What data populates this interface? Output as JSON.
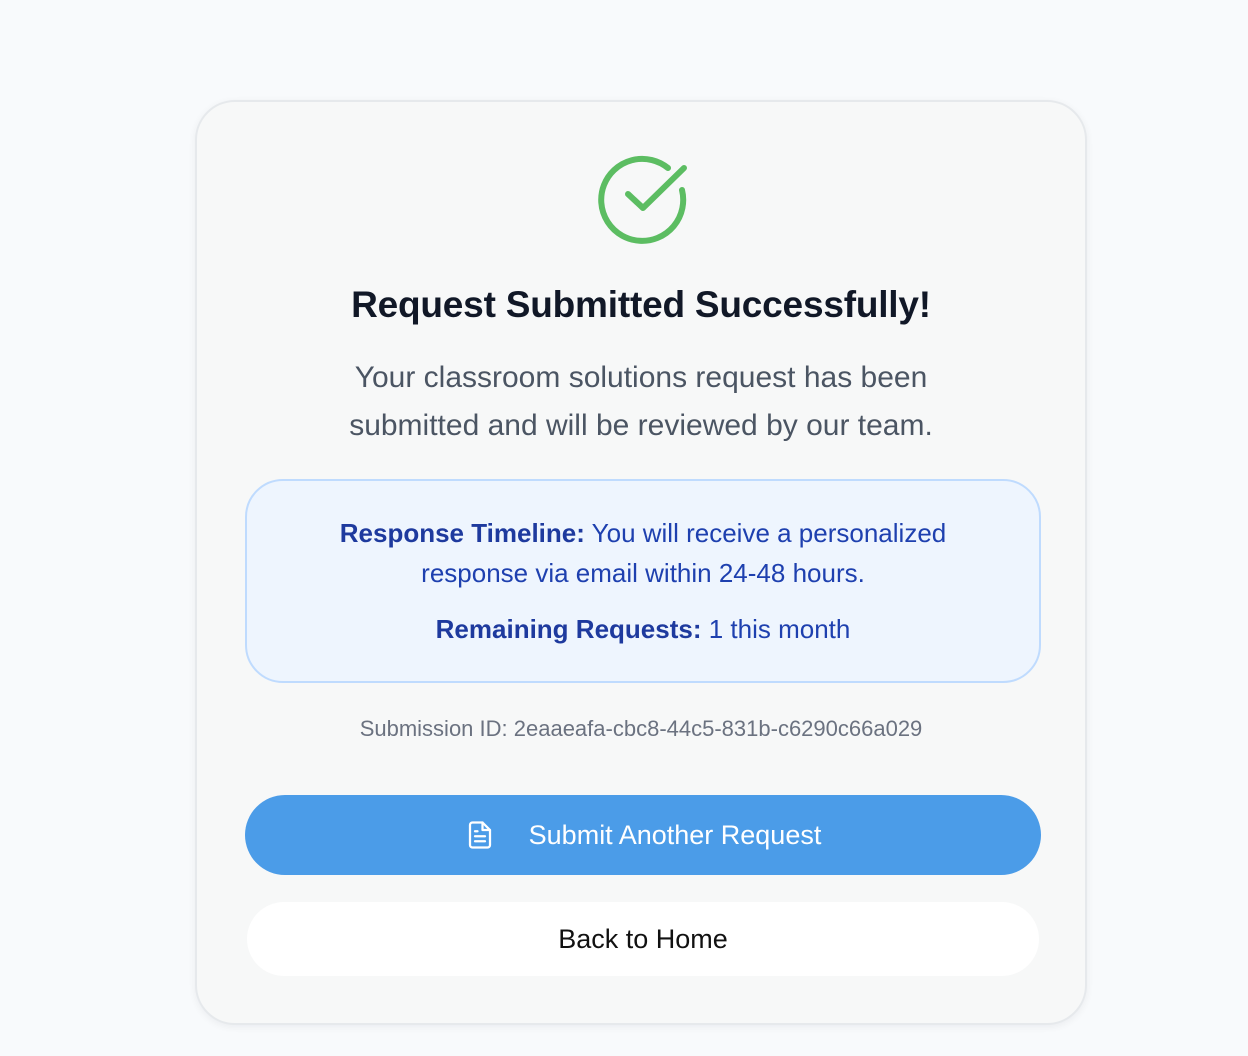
{
  "card": {
    "title": "Request Submitted Successfully!",
    "subtitle": "Your classroom solutions request has been submitted and will be reviewed by our team.",
    "icon": "check-circle-icon"
  },
  "info": {
    "timeline_label": "Response Timeline:",
    "timeline_text": " You will receive a personalized response via email within 24-48 hours.",
    "remaining_label": "Remaining Requests:",
    "remaining_text": " 1 this month"
  },
  "submission": {
    "text": "Submission ID: 2eaaeafa-cbc8-44c5-831b-c6290c66a029"
  },
  "buttons": {
    "submit_another": "Submit Another Request",
    "submit_icon": "document-icon",
    "back_home": "Back to Home"
  },
  "colors": {
    "success": "#5cbd62",
    "primary": "#4b9ce8",
    "info_text": "#1e40af",
    "info_bg": "#eef5fe"
  }
}
